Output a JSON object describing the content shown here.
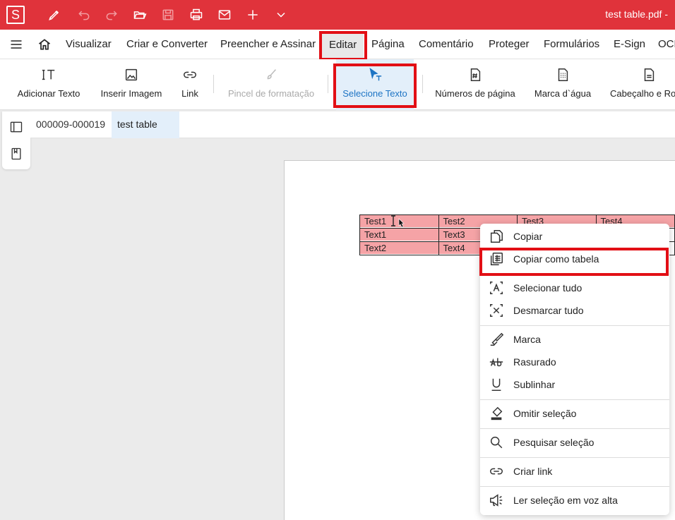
{
  "app": {
    "logo_letter": "S",
    "document_title": "test table.pdf  -",
    "accent_color": "#e0333b",
    "highlight_color": "#e20f15"
  },
  "quick_toolbar": [
    {
      "name": "pen-icon"
    },
    {
      "name": "undo-icon"
    },
    {
      "name": "redo-icon"
    },
    {
      "name": "folder-open-icon"
    },
    {
      "name": "save-icon"
    },
    {
      "name": "print-icon"
    },
    {
      "name": "mail-icon"
    },
    {
      "name": "plus-icon"
    },
    {
      "name": "chevron-down-icon"
    }
  ],
  "menu": {
    "items": [
      "Visualizar",
      "Criar e Converter",
      "Preencher e Assinar",
      "Editar",
      "Página",
      "Comentário",
      "Proteger",
      "Formulários",
      "E-Sign",
      "OCR"
    ],
    "active": "Editar"
  },
  "ribbon": {
    "buttons": [
      {
        "label": "Adicionar Texto",
        "icon": "text-add-icon"
      },
      {
        "label": "Inserir Imagem",
        "icon": "image-icon"
      },
      {
        "label": "Link",
        "icon": "link-icon"
      },
      {
        "label": "Pincel de formatação",
        "icon": "brush-icon",
        "disabled": true
      },
      {
        "label": "Selecione Texto",
        "icon": "select-text-icon",
        "selected": true
      },
      {
        "label": "Números de página",
        "icon": "page-number-icon"
      },
      {
        "label": "Marca d`água",
        "icon": "watermark-icon"
      },
      {
        "label": "Cabeçalho e Rodapé",
        "icon": "header-footer-icon"
      }
    ]
  },
  "tabs": [
    {
      "label": "000009-000019"
    },
    {
      "label": "test table",
      "active": true
    }
  ],
  "pdf_table": {
    "rows": [
      [
        "Test1",
        "Test2",
        "Test3",
        "Test4"
      ],
      [
        "Text1",
        "Text3",
        "",
        ""
      ],
      [
        "Text2",
        "Text4",
        "",
        ""
      ]
    ]
  },
  "context_menu": {
    "items": [
      {
        "label": "Copiar",
        "icon": "copy-icon"
      },
      {
        "label": "Copiar como tabela",
        "icon": "copy-table-icon",
        "highlighted": true
      },
      {
        "label": "Selecionar tudo",
        "icon": "select-all-icon"
      },
      {
        "label": "Desmarcar tudo",
        "icon": "deselect-all-icon"
      },
      {
        "label": "Marca",
        "icon": "highlighter-icon"
      },
      {
        "label": "Rasurado",
        "icon": "strikethrough-icon"
      },
      {
        "label": "Sublinhar",
        "icon": "underline-icon"
      },
      {
        "label": "Omitir seleção",
        "icon": "redact-icon"
      },
      {
        "label": "Pesquisar seleção",
        "icon": "search-icon"
      },
      {
        "label": "Criar link",
        "icon": "link-icon"
      },
      {
        "label": "Ler seleção em voz alta",
        "icon": "speaker-icon"
      }
    ]
  }
}
